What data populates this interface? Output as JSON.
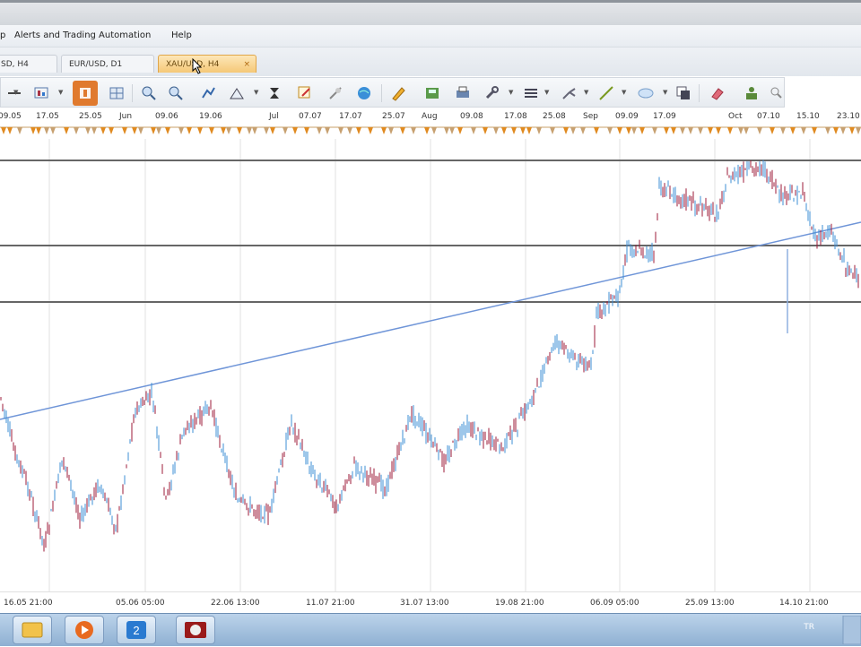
{
  "menu": {
    "items": [
      {
        "label": "p"
      },
      {
        "label": "Alerts and Trading Automation"
      },
      {
        "label": "Help"
      }
    ]
  },
  "tabs": [
    {
      "label": "SD, H4"
    },
    {
      "label": "EUR/USD, D1"
    },
    {
      "label": "XAU/USD, H4",
      "active": true,
      "close_glyph": "×"
    }
  ],
  "toolbar": {
    "icons": [
      "chart-arrow-dropdown-icon",
      "bar-chart-icon",
      "candlestick-toggle-icon",
      "grid-icon",
      "zoom-in-icon",
      "zoom-out-icon",
      "bar-style-icon",
      "line-style-icon",
      "cursor-icon",
      "drawing-tool-icon",
      "crosshair-icon",
      "globe-icon",
      "pencil-icon",
      "save-icon",
      "print-icon",
      "wrench-icon",
      "list-icon",
      "fork-icon",
      "line-tool-icon",
      "circle-icon",
      "copy-icon",
      "eraser-icon",
      "traders-icon",
      "search-icon"
    ]
  },
  "date_scale": {
    "labels": [
      "09.05",
      "17.05",
      "25.05",
      "Jun",
      "09.06",
      "19.06",
      "Jul",
      "07.07",
      "17.07",
      "25.07",
      "Aug",
      "09.08",
      "17.08",
      "25.08",
      "Sep",
      "09.09",
      "17.09",
      "Oct",
      "07.10",
      "15.10",
      "23.10"
    ]
  },
  "time_axis": {
    "labels": [
      "16.05 21:00",
      "05.06 05:00",
      "22.06 13:00",
      "11.07 21:00",
      "31.07 13:00",
      "19.08 21:00",
      "06.09 05:00",
      "25.09 13:00",
      "14.10 21:00"
    ]
  },
  "colors": {
    "bull": "#3d8fd6",
    "bear": "#9c1b3a",
    "trendline": "#6f95d8",
    "sr_line": "#555555",
    "accent": "#e07a2e"
  },
  "taskbar": {
    "items": [
      "file-explorer-icon",
      "media-player-icon",
      "app-icon",
      "speaker-icon"
    ],
    "tray_label": "TR"
  }
}
